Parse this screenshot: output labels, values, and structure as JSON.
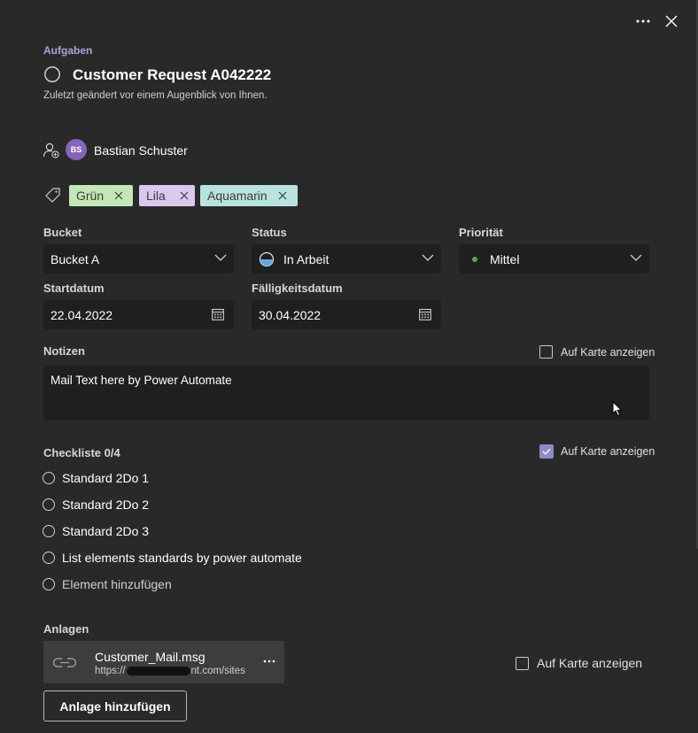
{
  "header": {
    "section": "Aufgaben",
    "title": "Customer Request A042222",
    "subtitle": "Zuletzt geändert vor einem Augenblick von Ihnen."
  },
  "assignee": {
    "initials": "BS",
    "name": "Bastian Schuster",
    "avatar_color": "#8764b8"
  },
  "labels": [
    {
      "text": "Grün",
      "color": "#c3e7b5"
    },
    {
      "text": "Lila",
      "color": "#d9c9ef"
    },
    {
      "text": "Aquamarin",
      "color": "#b9e3de"
    }
  ],
  "fields": {
    "bucket": {
      "label": "Bucket",
      "value": "Bucket A"
    },
    "status": {
      "label": "Status",
      "value": "In Arbeit"
    },
    "priority": {
      "label": "Priorität",
      "value": "Mittel",
      "dot_color": "#57a64a"
    },
    "start": {
      "label": "Startdatum",
      "value": "22.04.2022"
    },
    "due": {
      "label": "Fälligkeitsdatum",
      "value": "30.04.2022"
    }
  },
  "notes": {
    "label": "Notizen",
    "show_on_card": "Auf Karte anzeigen",
    "text": "Mail Text here by Power Automate"
  },
  "checklist": {
    "label": "Checkliste 0/4",
    "show_on_card": "Auf Karte anzeigen",
    "items": [
      "Standard 2Do 1",
      "Standard 2Do 2",
      "Standard 2Do 3",
      "List elements standards by power automate"
    ],
    "add_placeholder": "Element hinzufügen"
  },
  "attachments": {
    "label": "Anlagen",
    "file_name": "Customer_Mail.msg",
    "file_url": "https://",
    "file_url_tail": "nt.com/sites",
    "show_on_card": "Auf Karte anzeigen",
    "add_button": "Anlage hinzufügen"
  },
  "accent_color": "#8b8cc7"
}
